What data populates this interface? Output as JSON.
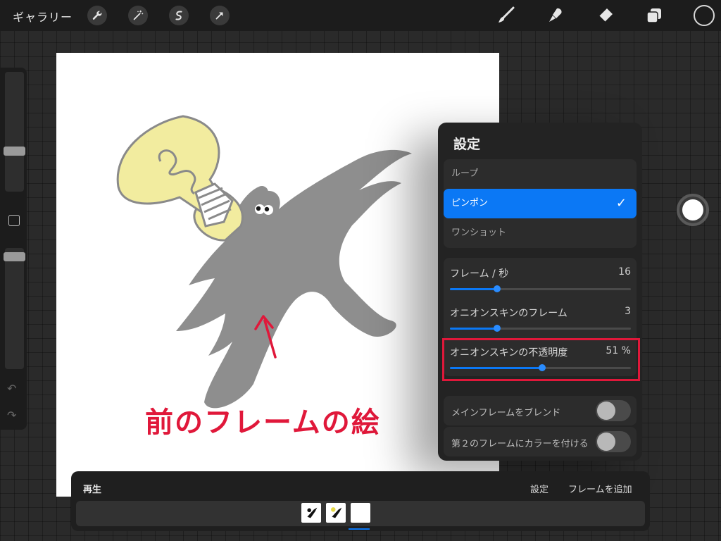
{
  "topbar": {
    "gallery_label": "ギャラリー",
    "left_tools": [
      "wrench-icon",
      "magic-wand-icon",
      "selection-icon",
      "transform-arrow-icon"
    ],
    "right_tools": [
      "brush-icon",
      "smudge-icon",
      "eraser-icon",
      "layers-icon",
      "color-swatch"
    ]
  },
  "canvas": {
    "annotation": "前のフレームの絵"
  },
  "settings": {
    "title": "設定",
    "play_modes": [
      {
        "label": "ループ",
        "selected": false
      },
      {
        "label": "ピンポン",
        "selected": true
      },
      {
        "label": "ワンショット",
        "selected": false
      }
    ],
    "sliders": [
      {
        "label": "フレーム / 秒",
        "value": "16",
        "fraction": 0.26
      },
      {
        "label": "オニオンスキンのフレーム",
        "value": "3",
        "fraction": 0.26
      },
      {
        "label": "オニオンスキンの不透明度",
        "value": "51 %",
        "fraction": 0.51
      }
    ],
    "toggles": [
      {
        "label": "メインフレームをブレンド",
        "on": false
      },
      {
        "label": "第２のフレームにカラーを付ける",
        "on": false
      }
    ]
  },
  "animation_bar": {
    "play_label": "再生",
    "settings_label": "設定",
    "add_frame_label": "フレームを追加",
    "frames": 3,
    "selected_frame": 3
  }
}
